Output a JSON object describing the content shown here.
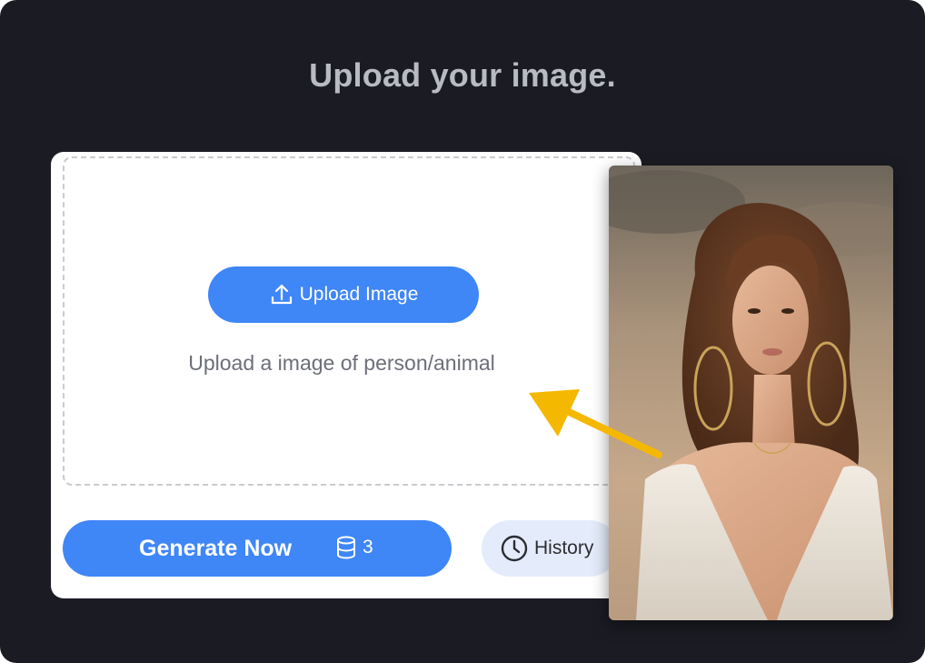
{
  "heading": "Upload your image.",
  "upload": {
    "button_label": "Upload Image",
    "button_icon": "upload-icon",
    "helper_text": "Upload a image of person/animal"
  },
  "generate": {
    "label": "Generate Now",
    "credits_icon": "database-icon",
    "credits": "3"
  },
  "history": {
    "label": "History",
    "icon": "clock-icon"
  },
  "example_photo": {
    "description_icon": "portrait-photo",
    "arrow_icon": "arrow-icon"
  },
  "colors": {
    "background": "#1b1c23",
    "card": "#ffffff",
    "primary": "#3f86f7",
    "history_bg": "#e4ecfb",
    "arrow": "#f5b800",
    "heading": "#b9bbc2"
  }
}
